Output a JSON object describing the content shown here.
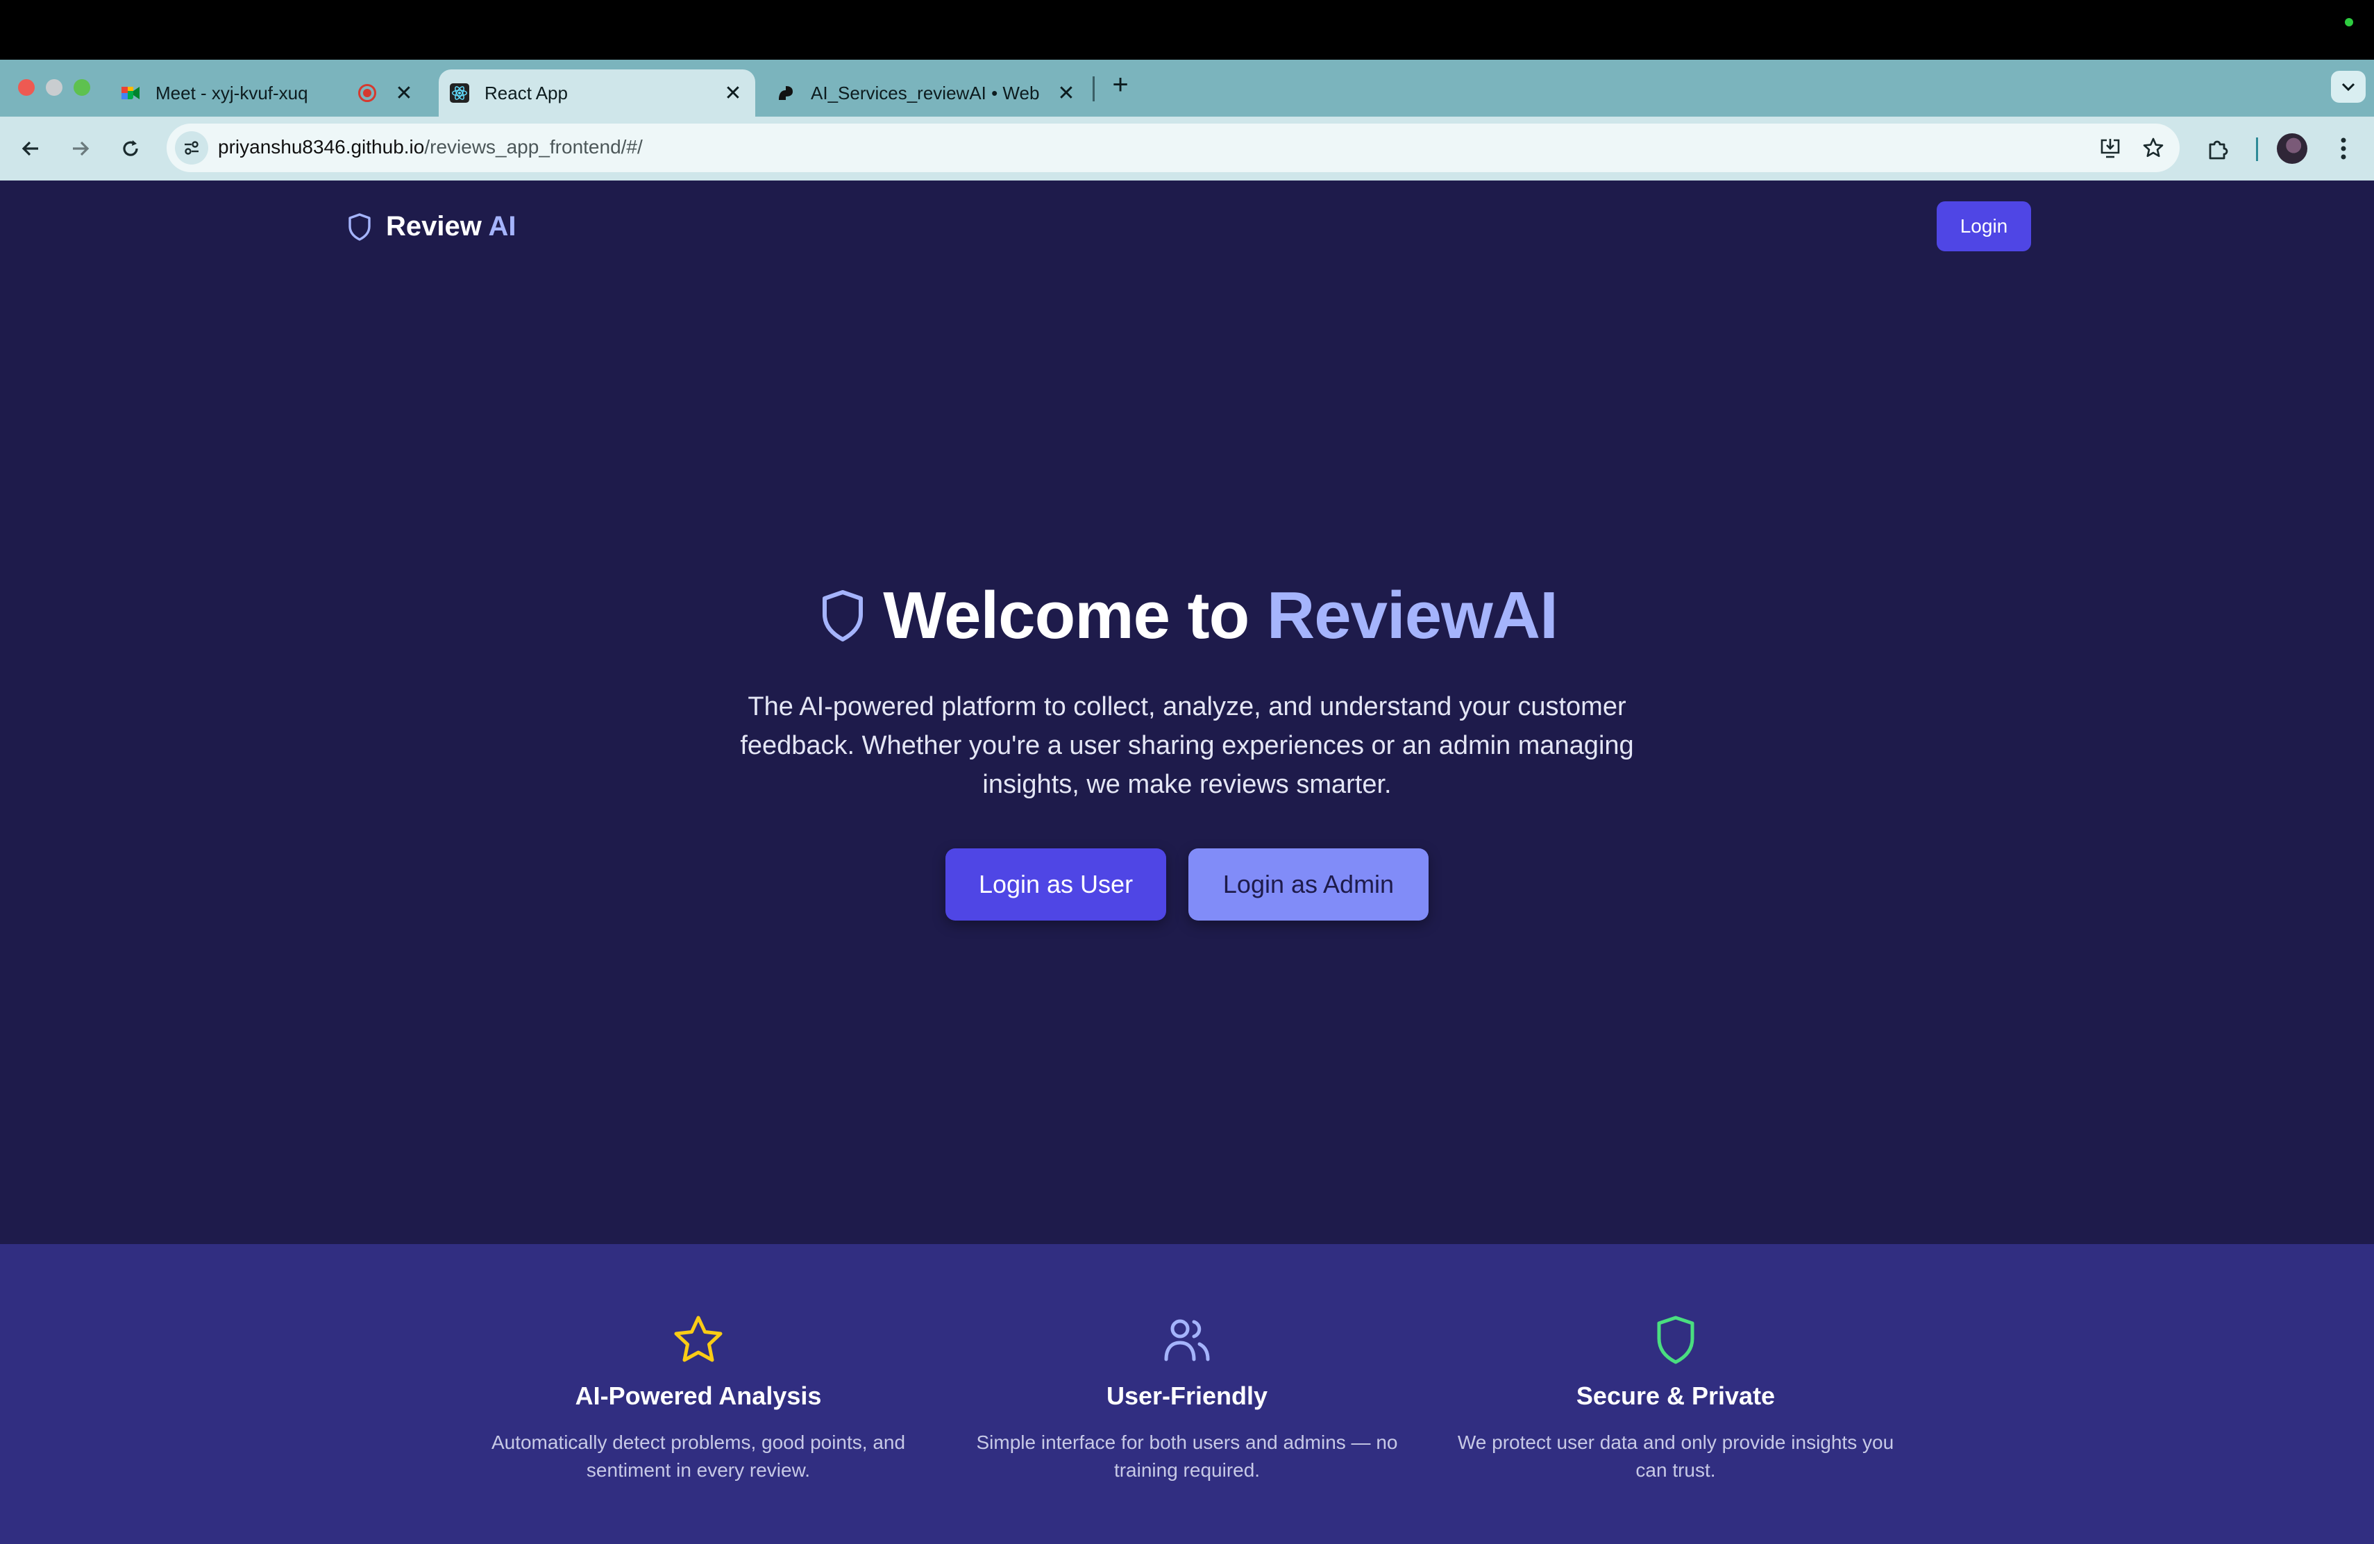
{
  "browser": {
    "tabs": [
      {
        "title": "Meet - xyj-kvuf-xuq",
        "recording": true
      },
      {
        "title": "React App",
        "active": true
      },
      {
        "title": "AI_Services_reviewAI • Web"
      }
    ],
    "url_host": "priyanshu8346.github.io",
    "url_path": "/reviews_app_frontend/#/"
  },
  "navbar": {
    "brand_main": "Review",
    "brand_accent": "AI",
    "login_label": "Login"
  },
  "hero": {
    "title_main": "Welcome to",
    "title_accent": "ReviewAI",
    "subtitle": "The AI-powered platform to collect, analyze, and understand your customer feedback. Whether you're a user sharing experiences or an admin managing insights, we make reviews smarter.",
    "login_user_label": "Login as User",
    "login_admin_label": "Login as Admin"
  },
  "features": [
    {
      "icon": "star-icon",
      "color": "#facc15",
      "title": "AI-Powered Analysis",
      "description": "Automatically detect problems, good points, and sentiment in every review."
    },
    {
      "icon": "users-icon",
      "color": "#a5b4fc",
      "title": "User-Friendly",
      "description": "Simple interface for both users and admins — no training required."
    },
    {
      "icon": "shield-icon",
      "color": "#4ade80",
      "title": "Secure & Private",
      "description": "We protect user data and only provide insights you can trust."
    }
  ],
  "colors": {
    "page_bg": "#1e1b4b",
    "features_bg": "#312e81",
    "primary": "#4f46e5",
    "secondary": "#818cf8",
    "accent_text": "#a5b4fc"
  }
}
